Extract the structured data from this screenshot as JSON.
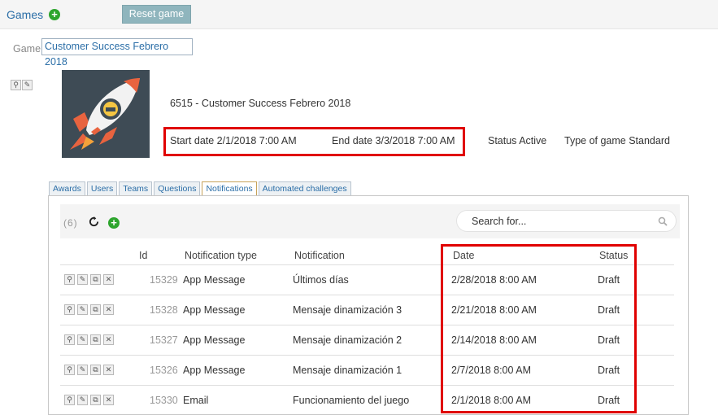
{
  "topbar": {
    "games_label": "Games",
    "add_icon": "plus-circle-icon",
    "reset_label": "Reset game"
  },
  "game_selector": {
    "label": "Game",
    "selected": "Customer Success Febrero 2018"
  },
  "game": {
    "name": "6515 - Customer Success Febrero 2018",
    "start_date": "Start date 2/1/2018 7:00 AM",
    "end_date": "End date 3/3/2018 7:00 AM",
    "status": "Status Active",
    "type": "Type of game Standard",
    "image_icon": "rocket-icon"
  },
  "tabs": [
    {
      "label": "Awards"
    },
    {
      "label": "Users"
    },
    {
      "label": "Teams"
    },
    {
      "label": "Questions"
    },
    {
      "label": "Notifications",
      "active": true
    },
    {
      "label": "Automated challenges"
    }
  ],
  "notifications": {
    "count": "(6)",
    "search_placeholder": "Search for...",
    "columns": {
      "id": "Id",
      "type": "Notification type",
      "notification": "Notification",
      "date": "Date",
      "status": "Status"
    },
    "rows": [
      {
        "id": "15329",
        "type": "App Message",
        "notification": "Últimos días",
        "date": "2/28/2018 8:00 AM",
        "status": "Draft"
      },
      {
        "id": "15328",
        "type": "App Message",
        "notification": "Mensaje dinamización 3",
        "date": "2/21/2018 8:00 AM",
        "status": "Draft"
      },
      {
        "id": "15327",
        "type": "App Message",
        "notification": "Mensaje dinamización 2",
        "date": "2/14/2018 8:00 AM",
        "status": "Draft"
      },
      {
        "id": "15326",
        "type": "App Message",
        "notification": "Mensaje dinamización 1",
        "date": "2/7/2018 8:00 AM",
        "status": "Draft"
      },
      {
        "id": "15330",
        "type": "Email",
        "notification": "Funcionamiento del juego",
        "date": "2/1/2018 8:00 AM",
        "status": "Draft"
      }
    ]
  },
  "colors": {
    "link": "#2b6ea7",
    "add": "#2ea52e",
    "highlight": "#e00000",
    "reset_button": "#8fb5bd"
  }
}
